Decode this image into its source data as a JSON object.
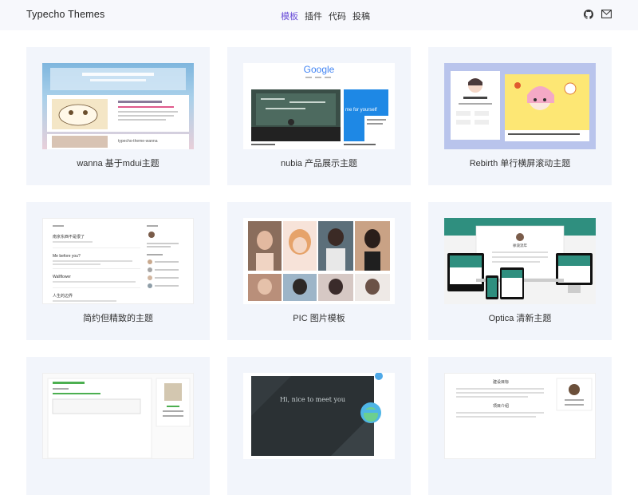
{
  "header": {
    "brand": "Typecho Themes",
    "nav": [
      {
        "label": "模板",
        "active": true
      },
      {
        "label": "插件",
        "active": false
      },
      {
        "label": "代码",
        "active": false
      },
      {
        "label": "投稿",
        "active": false
      }
    ],
    "icons": [
      "github-icon",
      "mail-icon"
    ]
  },
  "cards": [
    {
      "title": "wanna 基于mdui主题",
      "thumb": "wanna"
    },
    {
      "title": "nubia 产品展示主题",
      "thumb": "nubia"
    },
    {
      "title": "Rebirth 单行横屏滚动主题",
      "thumb": "rebirth"
    },
    {
      "title": "简约但精致的主题",
      "thumb": "simple"
    },
    {
      "title": "PIC 图片模板",
      "thumb": "pic"
    },
    {
      "title": "Optica 清新主题",
      "thumb": "optica"
    },
    {
      "title": "",
      "thumb": "generic"
    },
    {
      "title": "",
      "thumb": "dark"
    },
    {
      "title": "",
      "thumb": "doc"
    }
  ],
  "thumb_text": {
    "google_logo": "Google",
    "nubia_caption": "me for yourself",
    "simple_items": [
      "南京东西不是很了",
      "Me before you?",
      "Wallflower",
      "人生的边界"
    ],
    "optica_name": "徐浪流年",
    "dark_greeting": "Hi, nice to meet you",
    "wanna_post": "typecho-theme-wanna",
    "doc_heading": "建设目标",
    "doc_subheading": "项目介绍"
  },
  "colors": {
    "accent": "#6b4fd8",
    "header_bg": "#f7f8fc",
    "card_bg": "#f2f5fb"
  }
}
